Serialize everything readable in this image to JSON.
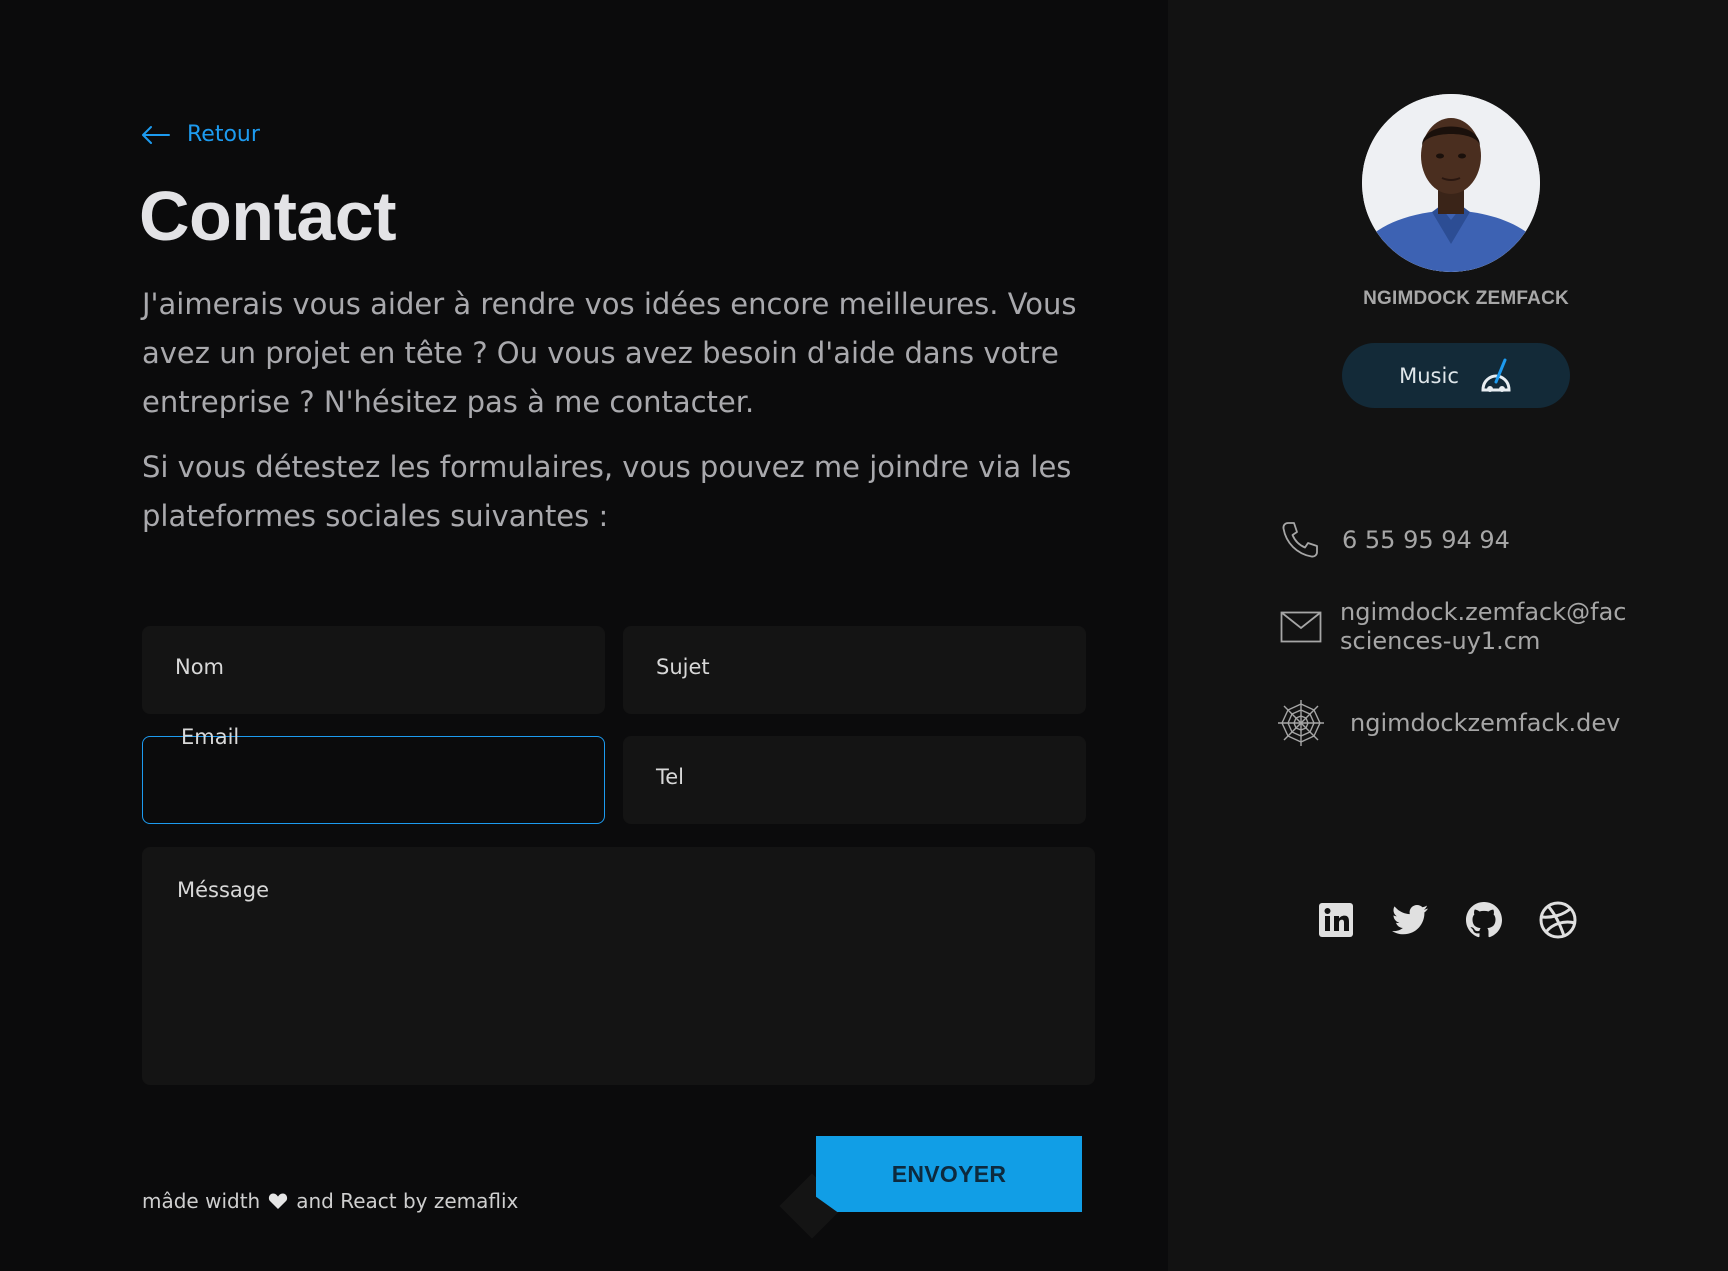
{
  "back": {
    "label": "Retour"
  },
  "page": {
    "title": "Contact",
    "intro_1": "J'aimerais vous aider à rendre vos idées encore meilleures. Vous avez un projet en tête ? Ou vous avez besoin d'aide dans votre entreprise ? N'hésitez pas à me contacter.",
    "intro_2": "Si vous détestez les formulaires, vous pouvez me joindre via les plateformes sociales suivantes :"
  },
  "form": {
    "nom_label": "Nom",
    "sujet_label": "Sujet",
    "email_label": "Email",
    "tel_label": "Tel",
    "message_label": "Méssage",
    "submit_label": "ENVOYER"
  },
  "footer": {
    "before": "mâde width",
    "after": "and React by zemaflix"
  },
  "profile": {
    "name": "NGIMDOCK ZEMFACK",
    "music_label": "Music"
  },
  "contact": {
    "phone": "6  55 95 94 94",
    "email": "ngimdock.zemfack@facsciences-uy1.cm",
    "website": "ngimdockzemfack.dev"
  },
  "socials": [
    "linkedin-icon",
    "twitter-icon",
    "github-icon",
    "dribbble-icon"
  ],
  "colors": {
    "accent": "#1d9bf0",
    "button": "#119ee6",
    "background": "#0b0b0c",
    "sidebar": "#121212",
    "music_pill": "#132a38"
  }
}
